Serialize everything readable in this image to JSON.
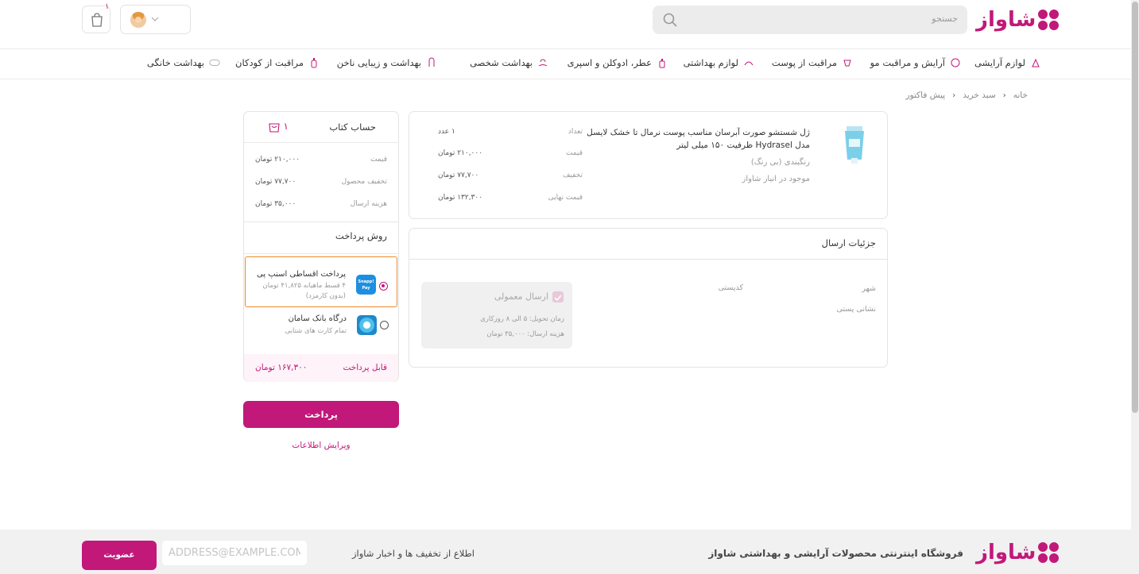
{
  "brand": {
    "logo_text": "شاواز",
    "accent": "#c2187a"
  },
  "header": {
    "search_placeholder": "جستجو",
    "cart_count": "۱"
  },
  "nav": {
    "items": [
      {
        "label": "لوازم آرایشی",
        "icon": "makeup-icon"
      },
      {
        "label": "آرایش و مراقبت مو",
        "icon": "hair-icon"
      },
      {
        "label": "مراقبت از پوست",
        "icon": "skincare-icon"
      },
      {
        "label": "لوازم بهداشتی",
        "icon": "hygiene-icon"
      },
      {
        "label": "عطر، ادوکلن و اسپری",
        "icon": "perfume-icon"
      },
      {
        "label": "بهداشت شخصی",
        "icon": "personal-care-icon"
      },
      {
        "label": "بهداشت و زیبایی ناخن",
        "icon": "nail-icon"
      },
      {
        "label": "مراقبت از کودکان",
        "icon": "baby-icon"
      },
      {
        "label": "بهداشت خانگی",
        "icon": "home-care-icon"
      }
    ]
  },
  "breadcrumb": {
    "home": "خانه",
    "cart": "سبد خرید",
    "current": "پیش فاکتور"
  },
  "product": {
    "title": "ژل شستشو صورت آبرسان مناسب پوست نرمال تا خشک لایسل مدل Hydrasel ظرفیت ۱۵۰ میلی لیتر",
    "color": "رنگبندی (بی رنگ)",
    "stock": "موجود در انبار شاواز",
    "qty_label": "تعداد",
    "qty_value": "۱ عدد",
    "price_label": "قیمت",
    "price_value": "۲۱۰,۰۰۰ تومان",
    "discount_label": "تخفیف",
    "discount_value": "۷۷,۷۰۰ تومان",
    "final_label": "قیمت نهایی",
    "final_value": "۱۳۲,۳۰۰ تومان"
  },
  "shipping": {
    "title": "جزئیات ارسال",
    "city_label": "شهر",
    "city_value": "کدپستی",
    "address_label": "نشانی پستی",
    "method_label": "ارسال معمولی",
    "delivery_time": "زمان تحویل: ۵ الی ۸ روزکاری",
    "cost": "هزینه ارسال: ۳۵,۰۰۰ تومان"
  },
  "summary": {
    "title": "حساب کتاب",
    "count": "۱",
    "price_label": "قیمت",
    "price_value": "۲۱۰,۰۰۰ تومان",
    "discount_label": "تخفیف محصول",
    "discount_value": "۷۷,۷۰۰ تومان",
    "shipping_label": "هزینه ارسال",
    "shipping_value": "۳۵,۰۰۰ تومان",
    "payment_title": "روش پرداخت",
    "options": [
      {
        "name": "پرداخت اقساطی اسنپ پی",
        "desc1": "۴ قسط ماهیانه ۴۱,۸۲۵ تومان",
        "desc2": "(بدون کارمزد)",
        "logo_text": "Snapp! Pay",
        "selected": true
      },
      {
        "name": "درگاه بانک سامان",
        "desc1": "تمام کارت های شتابی",
        "selected": false
      }
    ],
    "payable_label": "قابل پرداخت",
    "payable_value": "۱۶۷,۳۰۰ تومان"
  },
  "actions": {
    "pay_label": "پرداخت",
    "edit_label": "ویرایش اطلاعات"
  },
  "footer": {
    "tagline": "فروشگاه اینترنتی محصولات آرایشی و بهداشتی شاواز",
    "newsletter_text": "اطلاع از تخفیف ها و اخبار شاواز",
    "email_placeholder": "ADDRESS@EXAMPLE.COM",
    "join_label": "عضویت"
  }
}
